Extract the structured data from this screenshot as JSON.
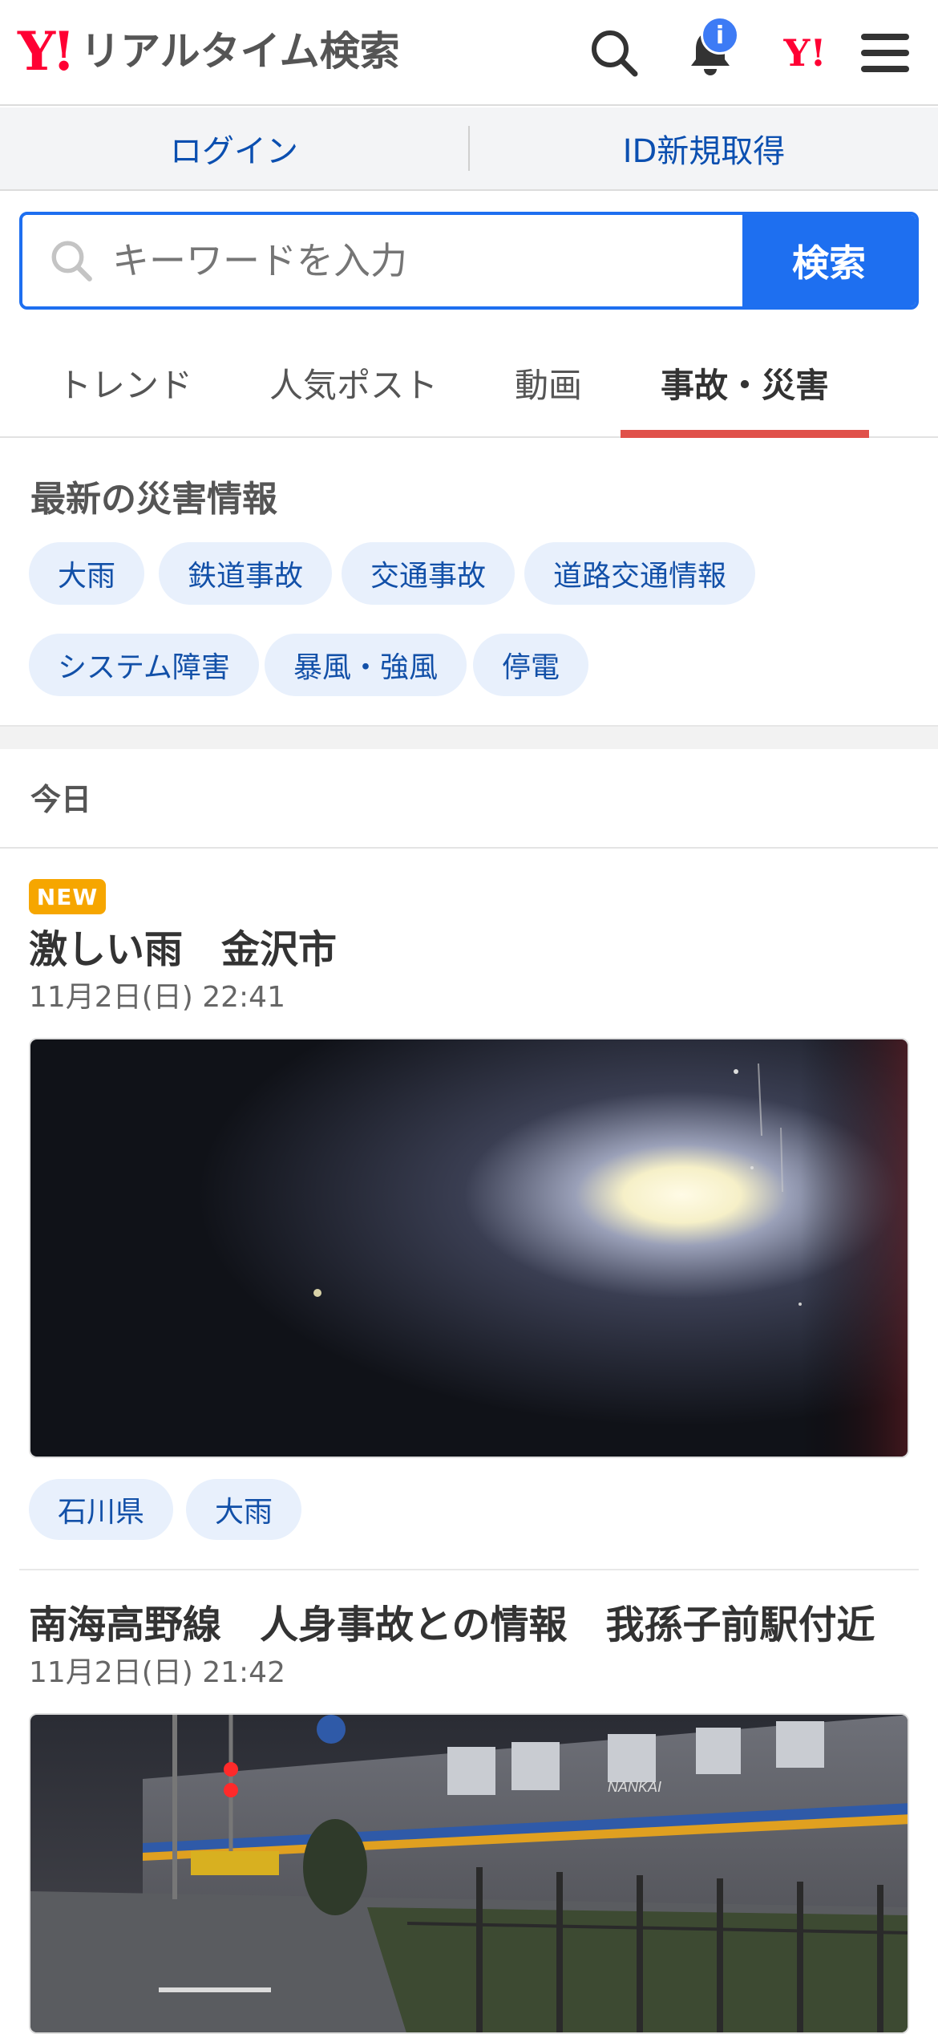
{
  "header": {
    "logo_mark": "Y!",
    "logo_text": "リアルタイム検索",
    "notification_badge": "i",
    "yahoo_mark": "Y!"
  },
  "auth": {
    "login_label": "ログイン",
    "signup_label": "ID新規取得"
  },
  "search": {
    "placeholder": "キーワードを入力",
    "button_label": "検索"
  },
  "tabs": [
    {
      "label": "トレンド"
    },
    {
      "label": "人気ポスト"
    },
    {
      "label": "動画"
    },
    {
      "label": "事故・災害",
      "active": true
    }
  ],
  "disaster": {
    "title": "最新の災害情報",
    "chips": [
      "大雨",
      "鉄道事故",
      "交通事故",
      "道路交通情報",
      "システム障害",
      "暴風・強風",
      "停電"
    ]
  },
  "day_label": "今日",
  "articles": [
    {
      "badge": "NEW",
      "title": "激しい雨　金沢市",
      "time": "11月2日(日) 22:41",
      "tags": [
        "石川県",
        "大雨"
      ]
    },
    {
      "title": "南海高野線　人身事故との情報　我孫子前駅付近",
      "time": "11月2日(日) 21:42",
      "train_logo": "NANKAI"
    }
  ],
  "colors": {
    "accent": "#1e6ff0",
    "brand_red": "#ff0033",
    "tab_underline": "#e0514a",
    "chip_bg": "#e8f0fc",
    "new_badge": "#f6a600"
  }
}
